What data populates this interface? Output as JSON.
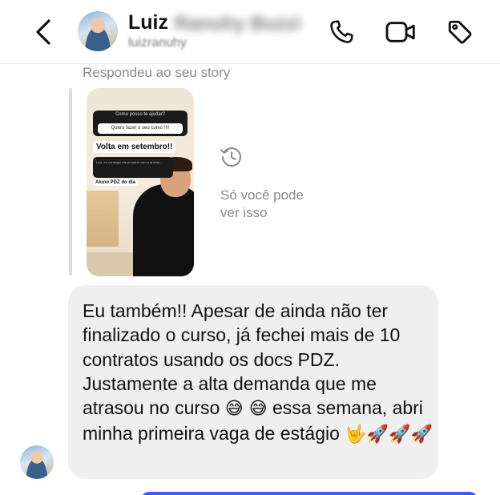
{
  "header": {
    "name": "Luiz",
    "surname": "Ranuhy Buzzi",
    "username": "luizranuhy",
    "icons": {
      "back": "chevron-left-icon",
      "phone": "phone-icon",
      "video": "video-camera-icon",
      "tag": "tag-icon"
    }
  },
  "story_reply": {
    "note": "Respondeu ao seu story",
    "story": {
      "question": "Como posso te ajudar?",
      "answer": "Quero fazer o seu curso !!!!",
      "highlight": "Volta em setembro!!",
      "caption": "Luiz, eu consegui me preparar com a dúvida...",
      "badge": "Aluno PDZ do dia"
    },
    "ephemeral_icon": "history-icon",
    "ephemeral_text": "Só você pode ver isso"
  },
  "message": {
    "text": "Eu também!! Apesar de ainda não ter finalizado o curso, já fechei mais de 10 contratos usando os docs PDZ. Justamente a alta demanda que me atrasou no curso",
    "emoji_mid": "😅 😅",
    "text_after": "essa semana, abri minha primeira vaga de estágio",
    "emoji_end": "🤟🚀🚀🚀"
  },
  "colors": {
    "bubble_incoming": "#efefef",
    "muted_text": "#8a8a8a",
    "outgoing_accent": "#3d5cf5"
  }
}
